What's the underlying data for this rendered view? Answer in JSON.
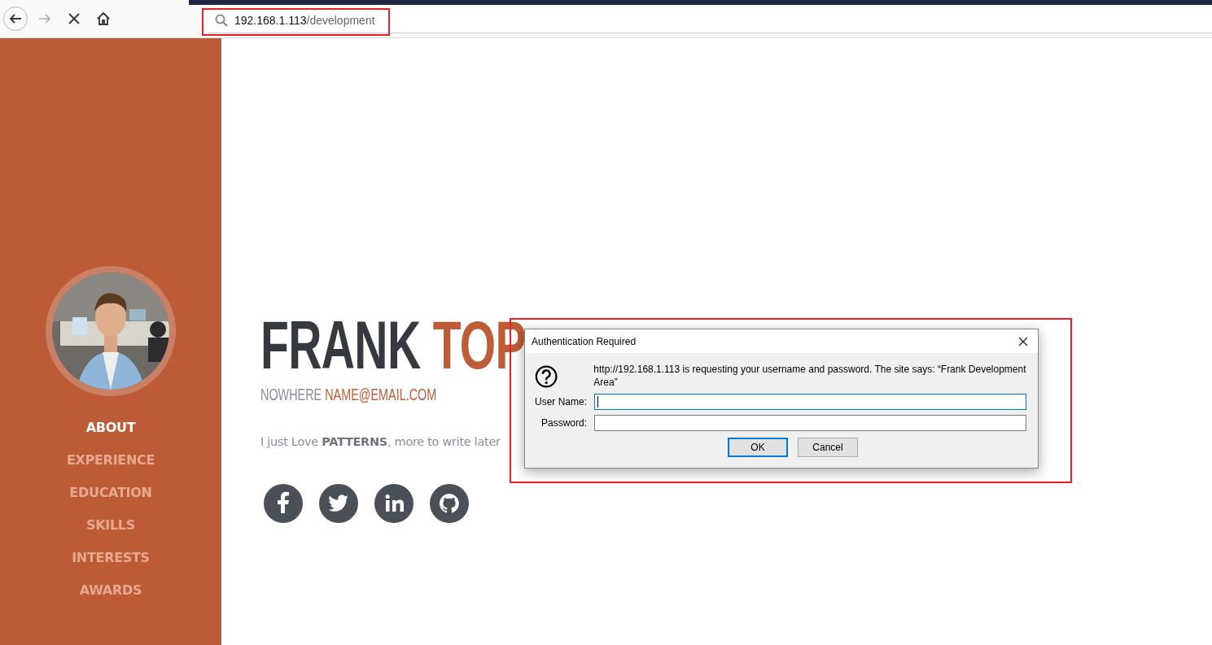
{
  "browser": {
    "address_host": "192.168.1.113",
    "address_path": "/development"
  },
  "sidebar": {
    "items": [
      {
        "label": "ABOUT",
        "selected": true
      },
      {
        "label": "EXPERIENCE",
        "selected": false
      },
      {
        "label": "EDUCATION",
        "selected": false
      },
      {
        "label": "SKILLS",
        "selected": false
      },
      {
        "label": "INTERESTS",
        "selected": false
      },
      {
        "label": "AWARDS",
        "selected": false
      }
    ]
  },
  "profile": {
    "first_name": "FRANK",
    "last_name": "TOP",
    "location": "NOWHERE",
    "email": "NAME@EMAIL.COM",
    "bio": "I just Love **PATTERNS**, more to write later"
  },
  "social": [
    {
      "kind": "facebook"
    },
    {
      "kind": "twitter"
    },
    {
      "kind": "linkedin"
    },
    {
      "kind": "github"
    }
  ],
  "dialog": {
    "title": "Authentication Required",
    "message": "http://192.168.1.113 is requesting your username and password. The site says: “Frank Development Area”",
    "fields": [
      {
        "label": "User Name:",
        "focused": true
      },
      {
        "label": "Password:",
        "focused": false
      }
    ],
    "buttons": [
      {
        "label": "OK",
        "default": true
      },
      {
        "label": "Cancel",
        "default": false
      }
    ]
  }
}
